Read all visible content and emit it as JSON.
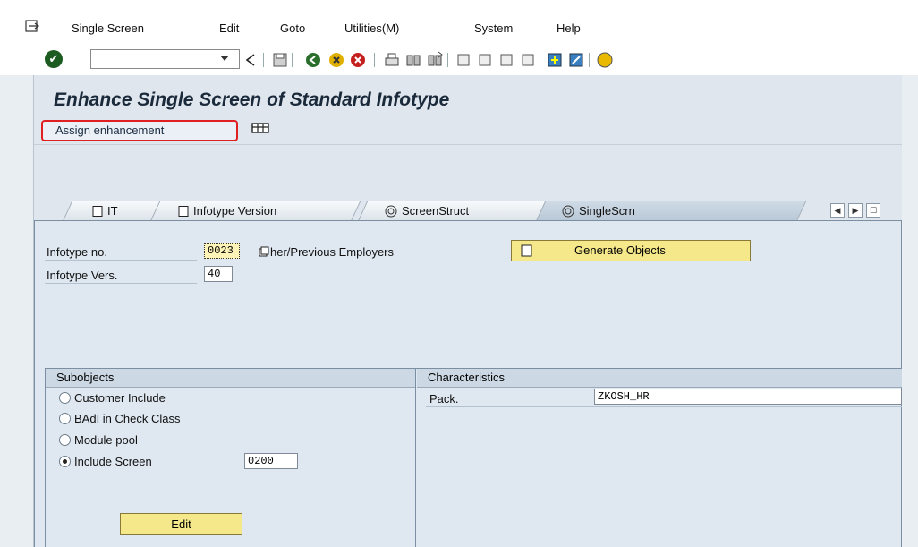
{
  "menubar": {
    "items": [
      "Single Screen",
      "Edit",
      "Goto",
      "Utilities(M)",
      "System",
      "Help"
    ]
  },
  "page": {
    "title": "Enhance Single Screen of Standard Infotype"
  },
  "appbar": {
    "assign_label": "Assign enhancement"
  },
  "tabs": [
    {
      "label": "IT",
      "icon": "document-icon"
    },
    {
      "label": "Infotype Version",
      "icon": "document-icon"
    },
    {
      "label": "ScreenStruct",
      "icon": "spiral-icon"
    },
    {
      "label": "SingleScrn",
      "icon": "spiral-icon"
    }
  ],
  "form": {
    "infotype_no_label": "Infotype no.",
    "infotype_no_value": "0023",
    "infotype_desc": "her/Previous Employers",
    "infotype_vers_label": "Infotype Vers.",
    "infotype_vers_value": "40",
    "generate_label": "Generate Objects"
  },
  "subobjects": {
    "header": "Subobjects",
    "options": [
      "Customer Include",
      "BAdI in Check Class",
      "Module pool",
      "Include Screen"
    ],
    "selected": "Include Screen",
    "include_screen_value": "0200",
    "edit_label": "Edit"
  },
  "characteristics": {
    "header": "Characteristics",
    "pack_label": "Pack.",
    "pack_value": "ZKOSH_HR"
  },
  "colors": {
    "accent_red": "#e02020",
    "button_yellow": "#f5e88a",
    "panel_bg": "#dfe8f1"
  }
}
